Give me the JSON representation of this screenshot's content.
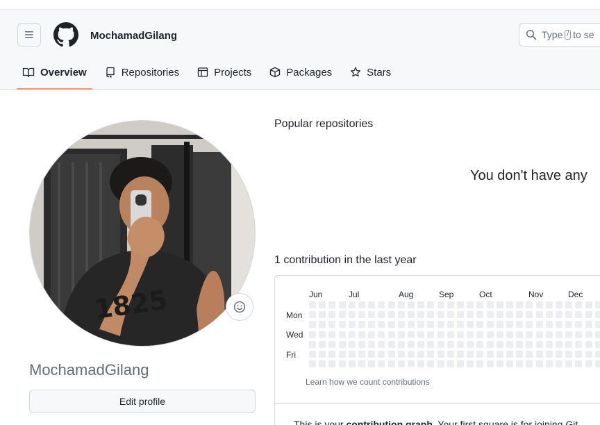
{
  "header": {
    "username": "MochamadGilang",
    "search": {
      "prefix": "Type",
      "slash": "/",
      "suffix": "to se"
    }
  },
  "tabs": [
    {
      "label": "Overview",
      "icon": "book-icon",
      "active": true
    },
    {
      "label": "Repositories",
      "icon": "repo-icon",
      "active": false
    },
    {
      "label": "Projects",
      "icon": "table-icon",
      "active": false
    },
    {
      "label": "Packages",
      "icon": "package-icon",
      "active": false
    },
    {
      "label": "Stars",
      "icon": "star-icon",
      "active": false
    }
  ],
  "profile": {
    "name": "MochamadGilang",
    "edit_label": "Edit profile"
  },
  "popular": {
    "title": "Popular repositories",
    "empty_message": "You don't have any"
  },
  "contributions": {
    "title": "1 contribution in the last year",
    "months": [
      "Jun",
      "Jul",
      "Aug",
      "Sep",
      "Oct",
      "Nov",
      "Dec"
    ],
    "days": [
      "Mon",
      "Wed",
      "Fri"
    ],
    "learn_link": "Learn how we count contributions",
    "footer_prefix": "This is your ",
    "footer_bold": "contribution graph",
    "footer_suffix": ". Your first square is for joining Git",
    "cell_color": "#ebedf0"
  },
  "colors": {
    "accent_underline": "#fd8c73",
    "border": "#d0d7de",
    "muted": "#656d76"
  }
}
